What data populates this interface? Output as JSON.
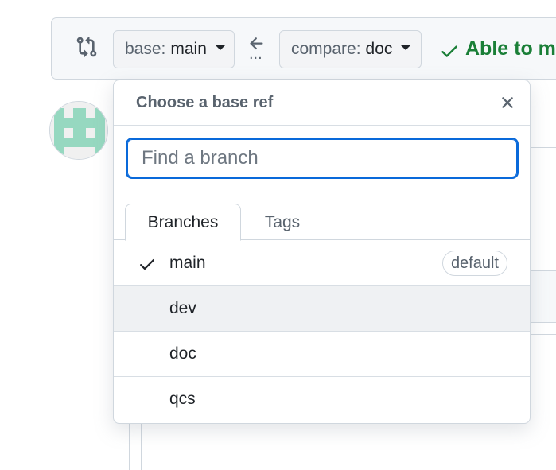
{
  "compare_bar": {
    "base": {
      "prefix": "base:",
      "ref": "main"
    },
    "compare": {
      "prefix": "compare:",
      "ref": "doc"
    },
    "ellipsis": "...",
    "merge_status": "Able to me"
  },
  "dropdown": {
    "title": "Choose a base ref",
    "search": {
      "placeholder": "Find a branch",
      "value": ""
    },
    "tabs": [
      {
        "label": "Branches",
        "active": true
      },
      {
        "label": "Tags",
        "active": false
      }
    ],
    "branches": [
      {
        "name": "main",
        "selected": true,
        "badge": "default"
      },
      {
        "name": "dev",
        "selected": false,
        "hover": true
      },
      {
        "name": "doc",
        "selected": false
      },
      {
        "name": "qcs",
        "selected": false
      }
    ]
  },
  "colors": {
    "accent": "#0969da",
    "success": "#1a7f37",
    "avatar": "#96d8c0",
    "border": "#d0d7de",
    "muted_text": "#59636e"
  }
}
